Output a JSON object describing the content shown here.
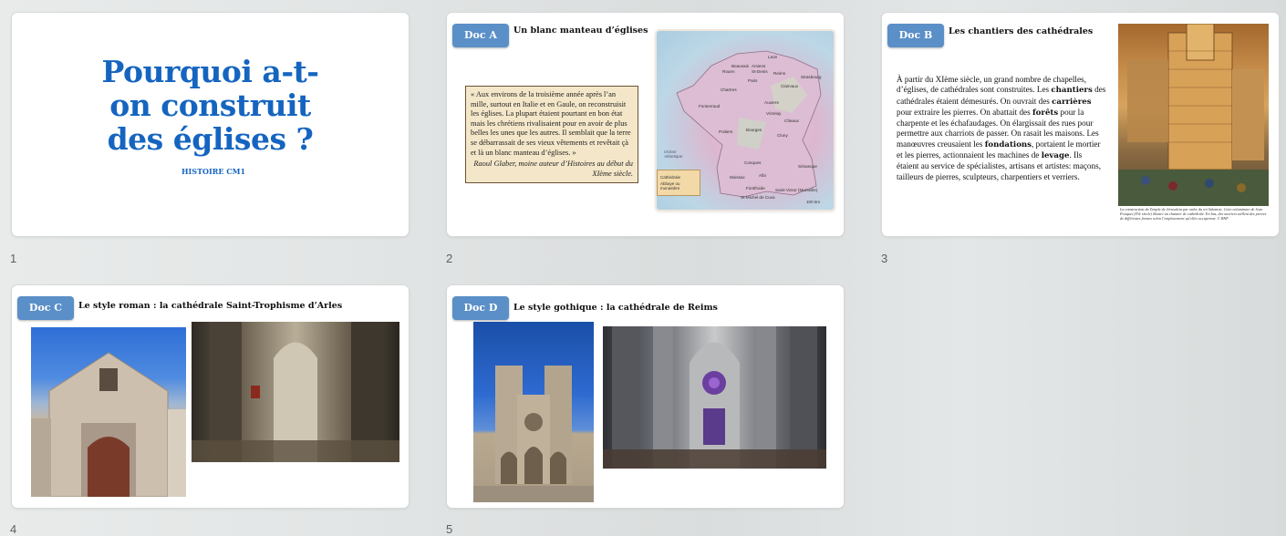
{
  "slides": [
    {
      "number": "1",
      "title": "Pourquoi a-t-on construit des églises ?",
      "subtitle": "HISTOIRE CM1"
    },
    {
      "number": "2",
      "badge": "Doc A",
      "title": "Un blanc manteau d’églises",
      "quote": "« Aux environs de la troisième année après l’an mille, surtout en Italie et en Gaule, on reconstruisit les églises. La plupart étaient pourtant en bon état mais les chrétiens rivalisaient pour en avoir de plus belles les unes que les autres. Il semblait que la terre se débarrassait de ses vieux vêtements et revêtait çà et là un blanc manteau d’églises. »",
      "quote_source": "Raoul Glaber, moine auteur d’Histoires au début du XIème siècle.",
      "map": {
        "legend": [
          "Cathédrale",
          "Abbaye ou monastère"
        ],
        "scale": "100 km",
        "ocean": "Océan Atlantique",
        "cities": [
          "Laon",
          "Beauvais",
          "Amiens",
          "St-Denis",
          "Reims",
          "Rouen",
          "Paris",
          "Strasbourg",
          "Chartres",
          "Clairvaux",
          "Fontevraud",
          "Auxerre",
          "Vézelay",
          "Bourges",
          "Cîteaux",
          "Poitiers",
          "Cluny",
          "Conques",
          "Sénanque",
          "Moissac",
          "Albi",
          "Fontfroide",
          "St-Michel de Cuxa",
          "Saint-Victor (Marseille)"
        ]
      }
    },
    {
      "number": "3",
      "badge": "Doc B",
      "title": "Les chantiers des cathédrales",
      "caption": "La construction du Temple de Jérusalem par ordre du roi Salomon. Cette enluminure de Jean Fouquet (XVe siècle) illustre un chantier de cathédrale. En bas, des ouvriers taillent des pierres de différentes formes selon l’emplacement qu’elles occuperont. © BNF"
    },
    {
      "number": "4",
      "badge": "Doc C",
      "title": "Le style roman : la cathédrale Saint-Trophisme d’Arles"
    },
    {
      "number": "5",
      "badge": "Doc D",
      "title": "Le style gothique : la cathédrale de Reims"
    }
  ]
}
